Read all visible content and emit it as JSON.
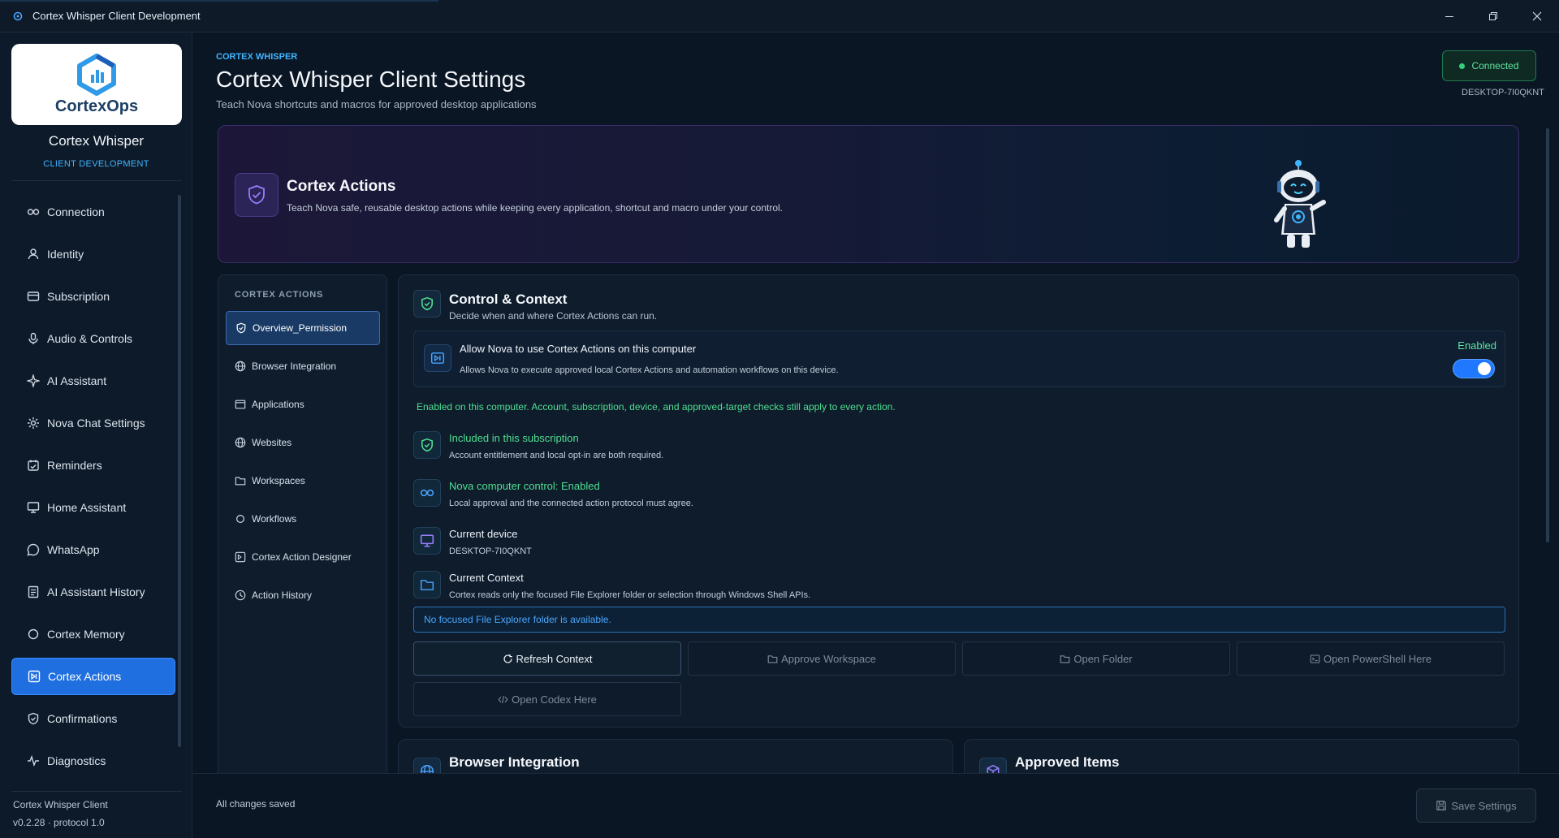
{
  "window": {
    "title": "Cortex Whisper Client Development",
    "controls": [
      "minimize",
      "restore",
      "close"
    ]
  },
  "sidebar": {
    "logo_text": "CortexOps",
    "app_name": "Cortex Whisper",
    "app_subtitle": "CLIENT DEVELOPMENT",
    "items": [
      {
        "label": "Connection",
        "icon": "link-icon"
      },
      {
        "label": "Identity",
        "icon": "user-icon"
      },
      {
        "label": "Subscription",
        "icon": "card-icon"
      },
      {
        "label": "Audio & Controls",
        "icon": "microphone-icon"
      },
      {
        "label": "AI Assistant",
        "icon": "sparkle-icon"
      },
      {
        "label": "Nova Chat Settings",
        "icon": "gear-icon"
      },
      {
        "label": "Reminders",
        "icon": "calendar-icon"
      },
      {
        "label": "Home Assistant",
        "icon": "monitor-icon"
      },
      {
        "label": "WhatsApp",
        "icon": "chat-icon"
      },
      {
        "label": "AI Assistant History",
        "icon": "document-icon"
      },
      {
        "label": "Cortex Memory",
        "icon": "circle-icon"
      },
      {
        "label": "Cortex Actions",
        "icon": "actions-icon",
        "active": true
      },
      {
        "label": "Confirmations",
        "icon": "shield-icon"
      },
      {
        "label": "Diagnostics",
        "icon": "pulse-icon"
      }
    ],
    "footer_name": "Cortex Whisper Client",
    "footer_version": "v0.2.28 · protocol 1.0"
  },
  "header": {
    "eyebrow": "CORTEX WHISPER",
    "title": "Cortex Whisper Client Settings",
    "subtitle": "Teach Nova shortcuts and macros for approved desktop applications",
    "status": "Connected",
    "device": "DESKTOP-7I0QKNT"
  },
  "hero": {
    "title": "Cortex Actions",
    "description": "Teach Nova safe, reusable desktop actions while keeping every application, shortcut and macro under your control."
  },
  "subnav": {
    "heading": "CORTEX ACTIONS",
    "items": [
      {
        "label": "Overview_Permission",
        "icon": "shield-check-icon",
        "active": true
      },
      {
        "label": "Browser Integration",
        "icon": "globe-icon"
      },
      {
        "label": "Applications",
        "icon": "window-icon"
      },
      {
        "label": "Websites",
        "icon": "globe-icon"
      },
      {
        "label": "Workspaces",
        "icon": "folder-icon"
      },
      {
        "label": "Workflows",
        "icon": "circle-icon"
      },
      {
        "label": "Cortex Action Designer",
        "icon": "designer-icon"
      },
      {
        "label": "Action History",
        "icon": "history-icon"
      }
    ]
  },
  "control": {
    "title": "Control & Context",
    "description": "Decide when and where Cortex Actions can run.",
    "allow_title": "Allow Nova to use Cortex Actions on this computer",
    "allow_description": "Allows Nova to execute approved local Cortex Actions and automation workflows on this device.",
    "allow_state": "Enabled",
    "allow_enabled": true,
    "enabled_note": "Enabled on this computer. Account, subscription, device, and approved-target checks still apply to every action.",
    "rows": [
      {
        "title": "Included in this subscription",
        "description": "Account entitlement and local opt-in are both required.",
        "icon": "shield-check-icon",
        "status": "green"
      },
      {
        "title": "Nova computer control: Enabled",
        "description": "Local approval and the connected action protocol must agree.",
        "icon": "link-icon",
        "status": "green"
      },
      {
        "title": "Current device",
        "description": "DESKTOP-7I0QKNT",
        "icon": "monitor-icon",
        "status": "neutral"
      },
      {
        "title": "Current Context",
        "description": "Cortex reads only the focused File Explorer folder or selection through Windows Shell APIs.",
        "icon": "folder-icon",
        "status": "neutral"
      }
    ],
    "notice": "No focused File Explorer folder is available.",
    "buttons": [
      {
        "label": "Refresh Context",
        "icon": "refresh-icon",
        "enabled": true
      },
      {
        "label": "Approve Workspace",
        "icon": "folder-icon",
        "enabled": false
      },
      {
        "label": "Open Folder",
        "icon": "folder-icon",
        "enabled": false
      },
      {
        "label": "Open PowerShell Here",
        "icon": "terminal-icon",
        "enabled": false
      },
      {
        "label": "Open Codex Here",
        "icon": "code-icon",
        "enabled": false
      }
    ]
  },
  "lower": {
    "browser_title": "Browser Integration",
    "approved_title": "Approved Items"
  },
  "footer": {
    "status": "All changes saved",
    "save_label": "Save Settings"
  },
  "colors": {
    "accent": "#1f6fe0",
    "success": "#4fdf8f",
    "info": "#3fb5ff",
    "background": "#0b1624"
  }
}
